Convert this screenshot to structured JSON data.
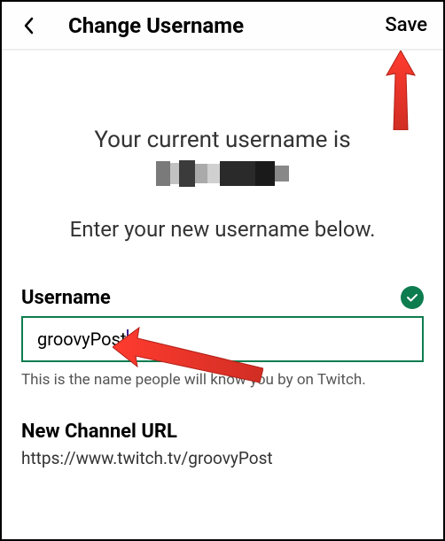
{
  "header": {
    "title": "Change Username",
    "save_label": "Save"
  },
  "main": {
    "current_username_prefix": "Your current username is",
    "instruction": "Enter your new username below.",
    "username_label": "Username",
    "username_value": "groovyPost",
    "username_hint": "This is the name people will know you by on Twitch.",
    "new_url_label": "New Channel URL",
    "new_url_value": "https://www.twitch.tv/groovyPost"
  }
}
